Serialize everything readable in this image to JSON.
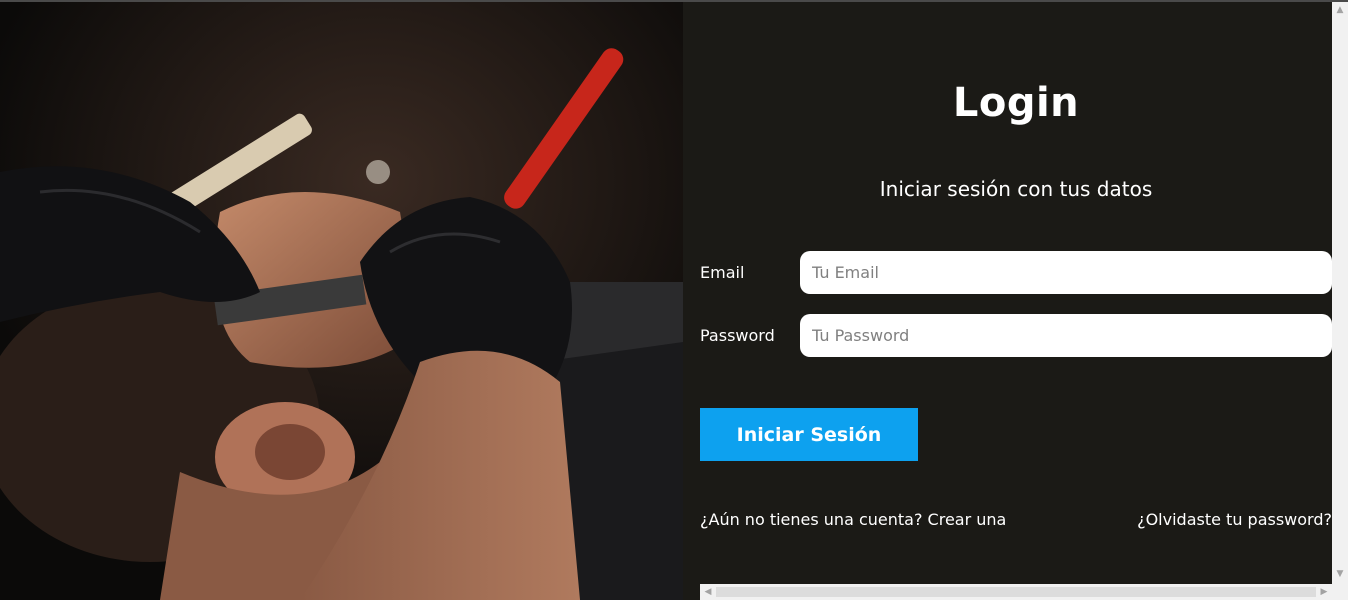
{
  "hero": {
    "image_description_icon": "barber-shaving-photo"
  },
  "login": {
    "title": "Login",
    "subtitle": "Iniciar sesión con tus datos",
    "email_label": "Email",
    "email_placeholder": "Tu Email",
    "email_value": "",
    "password_label": "Password",
    "password_placeholder": "Tu Password",
    "password_value": "",
    "submit_label": "Iniciar Sesión",
    "create_account_link": "¿Aún no tienes una cuenta? Crear una",
    "forgot_password_link": "¿Olvidaste tu password?"
  },
  "colors": {
    "panel_background": "#1b1a16",
    "button_background": "#0da1ef",
    "text": "#ffffff"
  }
}
